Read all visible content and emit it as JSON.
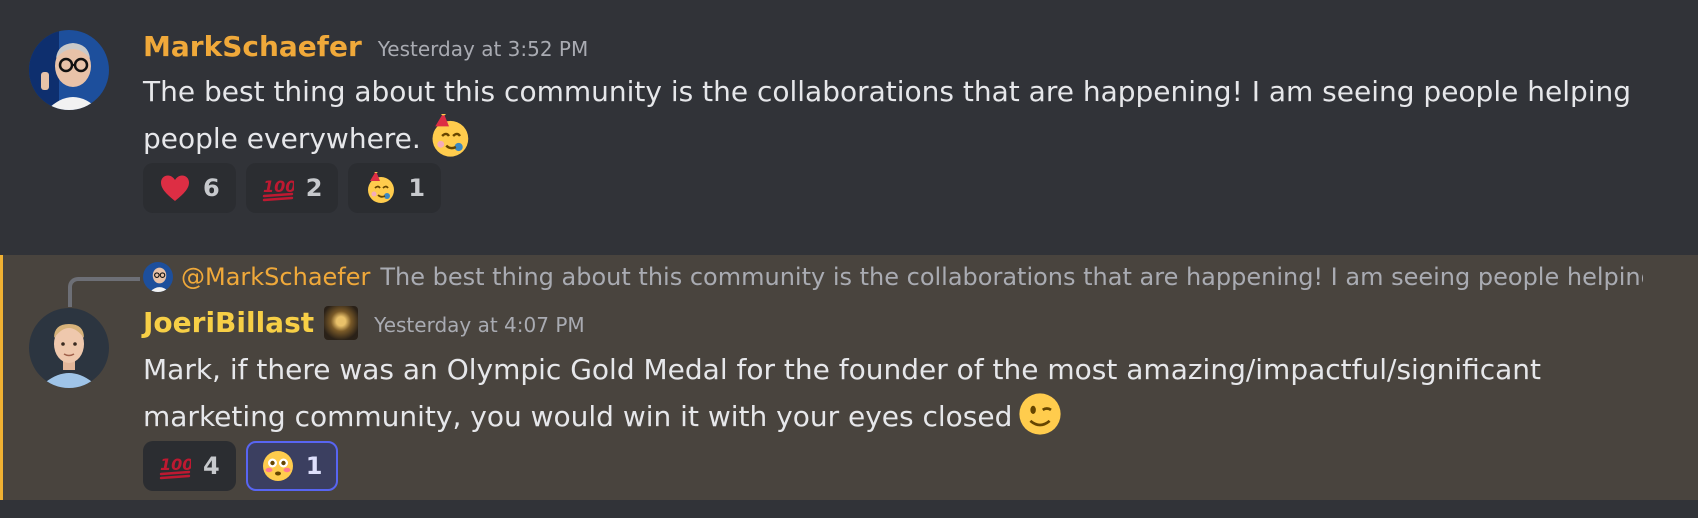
{
  "messages": [
    {
      "author": "MarkSchaefer",
      "timestamp": "Yesterday at 3:52 PM",
      "text_line1": "The best thing about this community is the collaborations that are happening! I am seeing people helping",
      "text_line2": "people everywhere.",
      "inline_emoji": "partying-face",
      "reactions": [
        {
          "emoji": "heart",
          "count": "6"
        },
        {
          "emoji": "hundred-points",
          "count": "2"
        },
        {
          "emoji": "partying-face",
          "count": "1"
        }
      ]
    },
    {
      "author": "JoeriBillast",
      "timestamp": "Yesterday at 4:07 PM",
      "reply": {
        "mention": "@MarkSchaefer",
        "excerpt": "The best thing about this community is the collaborations that are happening! I am seeing people helping people everywhere."
      },
      "text_line1": "Mark, if there was an Olympic Gold Medal for the founder of the most amazing/impactful/significant",
      "text_line2": "marketing community, you would win it with your eyes closed",
      "inline_emoji": "winking-face",
      "reactions": [
        {
          "emoji": "hundred-points",
          "count": "4"
        },
        {
          "emoji": "flushed-face",
          "count": "1",
          "active": true
        }
      ]
    }
  ],
  "colors": {
    "background": "#313338",
    "highlight": "#49443e",
    "author1": "#f0a93a",
    "author2": "#f7cf46",
    "reaction_active_border": "#5865f2"
  }
}
